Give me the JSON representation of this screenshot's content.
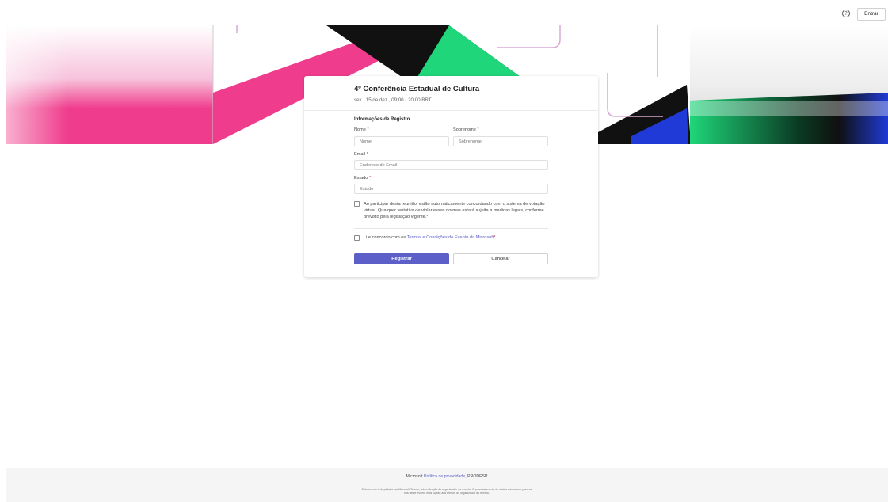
{
  "topbar": {
    "help_icon": "?",
    "signin_label": "Entrar"
  },
  "banner": {
    "colors": {
      "pink": "#f03c8c",
      "black": "#111111",
      "green": "#1fd67a",
      "blue": "#1f3ad6",
      "outline": "#d9a8d6"
    }
  },
  "event": {
    "title": "4º Conferência Estadual de Cultura",
    "date": "sex., 15 de dez., 09:00 - 20:00 BRT"
  },
  "form": {
    "section_title": "Informações de Registro",
    "first_name": {
      "label": "Nome",
      "required": "*",
      "placeholder": "Nome"
    },
    "last_name": {
      "label": "Sobrenome",
      "required": "*",
      "placeholder": "Sobrenome"
    },
    "email": {
      "label": "Email",
      "required": "*",
      "placeholder": "Endereço de Email"
    },
    "state": {
      "label": "Estado",
      "required": "*",
      "placeholder": "Estado"
    },
    "consent": {
      "text": "Ao participar desta reunião, estão automaticamente concordando com o sistema de votação virtual. Qualquer tentativa de violar essas normas estará sujeita a medidas legais, conforme previsto pela legislação vigente.",
      "required": "*"
    },
    "terms": {
      "prefix": "Li e concordo com os ",
      "link": "Termos e Condições do Evento da Microsoft",
      "required": "*"
    },
    "register_label": "Registrar",
    "cancel_label": "Cancelar",
    "accent": "#5b5fc7"
  },
  "footer": {
    "brand": "Microsoft",
    "privacy_link": "Política de privacidade",
    "org": "PRODESP",
    "note_line1": "Este evento é da plataforma Microsoft Teams, sob a direção do organizador do evento. O processamento de dados que ocorre para os",
    "note_line2": "fins deste evento está sujeito aos termos do organizador do evento."
  }
}
